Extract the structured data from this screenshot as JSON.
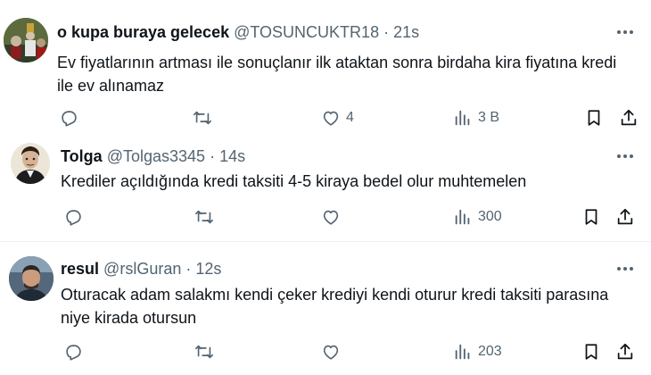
{
  "tweets": [
    {
      "name": "o kupa buraya gelecek",
      "handle": "@TOSUNCUKTR18",
      "dot": "·",
      "time": "21s",
      "text": "Ev fiyatlarının artması ile sonuçlanır ilk ataktan sonra birdaha kira fiyatına kredi ile ev alınamaz",
      "likes": "4",
      "views": "3 B"
    },
    {
      "name": "Tolga",
      "handle": "@Tolgas3345",
      "dot": "·",
      "time": "14s",
      "text": "Krediler açıldığında kredi taksiti 4-5 kiraya bedel olur muhtemelen",
      "likes": "",
      "views": "300"
    },
    {
      "name": "resul",
      "handle": "@rslGuran",
      "dot": "·",
      "time": "12s",
      "text": "Oturacak adam salakmı kendi çeker krediyi kendi oturur kredi taksiti parasına niye kirada otursun",
      "likes": "",
      "views": "203"
    }
  ],
  "icons": {
    "reply": "reply-icon",
    "retweet": "retweet-icon",
    "like": "heart-icon",
    "views": "views-chart-icon",
    "bookmark": "bookmark-icon",
    "share": "share-icon",
    "more": "more-icon"
  },
  "colors": {
    "text": "#0f1419",
    "secondary": "#536471",
    "divider": "#eff3f4"
  }
}
